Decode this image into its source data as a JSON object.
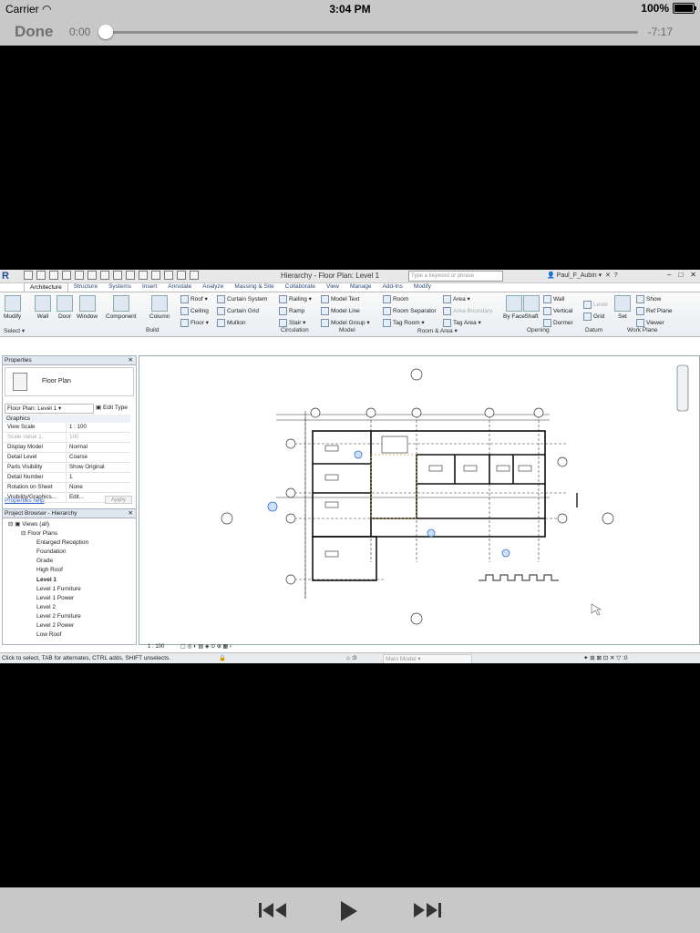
{
  "status": {
    "carrier": "Carrier",
    "time": "3:04 PM",
    "battery": "100%"
  },
  "player": {
    "done_label": "Done",
    "elapsed": "0:00",
    "remaining": "-7:17",
    "progress": 0.0
  },
  "revit": {
    "title": "Hierarchy - Floor Plan: Level 1",
    "search_placeholder": "Type a keyword or phrase",
    "user": "Paul_F_Aubin",
    "tabs": [
      "Architecture",
      "Structure",
      "Systems",
      "Insert",
      "Annotate",
      "Analyze",
      "Massing & Site",
      "Collaborate",
      "View",
      "Manage",
      "Add-Ins",
      "Modify"
    ],
    "ribbon": {
      "modify": "Modify",
      "select": "Select",
      "build_big": [
        "Wall",
        "Door",
        "Window",
        "Component",
        "Column"
      ],
      "build_small": [
        "Roof",
        "Ceiling",
        "Floor",
        "Curtain System",
        "Curtain Grid",
        "Mullion"
      ],
      "circulation": [
        "Railing",
        "Ramp",
        "Stair"
      ],
      "model": [
        "Model Text",
        "Model Line",
        "Model Group"
      ],
      "room_area": [
        "Room",
        "Room Separator",
        "Tag Room",
        "Area",
        "Area Boundary",
        "Tag Area"
      ],
      "opening_big": [
        "By Face",
        "Shaft"
      ],
      "opening_small": [
        "Wall",
        "Vertical",
        "Dormer"
      ],
      "datum": [
        "Level",
        "Grid"
      ],
      "work_plane_big": "Set",
      "work_plane_small": [
        "Show",
        "Ref Plane",
        "Viewer"
      ],
      "panels": [
        "Build",
        "Circulation",
        "Model",
        "Room & Area",
        "Opening",
        "Datum",
        "Work Plane"
      ]
    },
    "properties": {
      "title": "Properties",
      "type_name": "Floor Plan",
      "view_selector": "Floor Plan: Level 1",
      "edit_type": "Edit Type",
      "category": "Graphics",
      "rows": [
        {
          "k": "View Scale",
          "v": "1 : 100"
        },
        {
          "k": "Scale Value    1:",
          "v": "100"
        },
        {
          "k": "Display Model",
          "v": "Normal"
        },
        {
          "k": "Detail Level",
          "v": "Coarse"
        },
        {
          "k": "Parts Visibility",
          "v": "Show Original"
        },
        {
          "k": "Detail Number",
          "v": "1"
        },
        {
          "k": "Rotation on Sheet",
          "v": "None"
        },
        {
          "k": "Visibility/Graphics...",
          "v": "Edit..."
        }
      ],
      "help": "Properties help",
      "apply": "Apply"
    },
    "browser": {
      "title": "Project Browser - Hierarchy",
      "views": "Views (all)",
      "floor_plans": "Floor Plans",
      "items": [
        "Enlarged Reception",
        "Foundation",
        "Grade",
        "High Roof",
        "Level 1",
        "Level 1 Furniture",
        "Level 1 Power",
        "Level 2",
        "Level 2 Furniture",
        "Level 2 Power",
        "Low Roof"
      ]
    },
    "view_scale_label": "1 : 100",
    "status_text": "Click to select, TAB for alternates, CTRL adds, SHIFT unselects.",
    "status_zero": ":0",
    "main_model": "Main Model",
    "status_zero_right": ":0"
  }
}
